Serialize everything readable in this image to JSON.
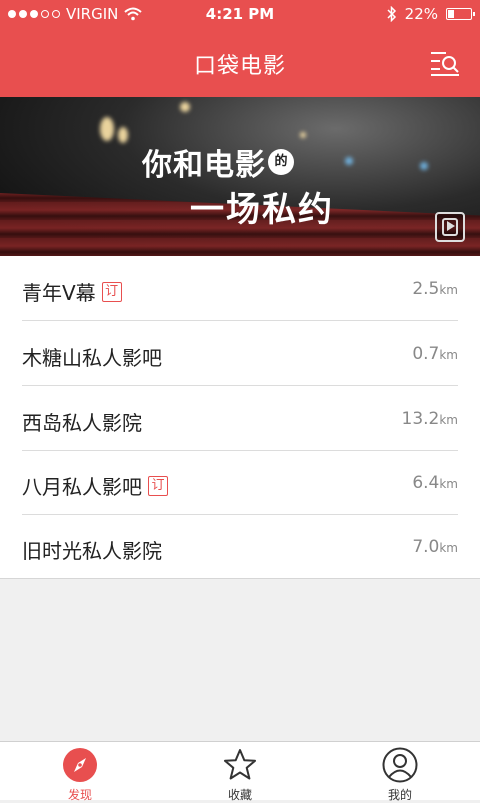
{
  "status_bar": {
    "carrier": "VIRGIN",
    "time": "4:21 PM",
    "battery": "22%"
  },
  "header": {
    "title": "口袋电影"
  },
  "banner": {
    "line1": "你和电影",
    "badge": "的",
    "line2": "一场私约"
  },
  "cinemas": [
    {
      "name": "青年V幕",
      "tag": "订",
      "distance": "2.5",
      "unit": "km"
    },
    {
      "name": "木糖山私人影吧",
      "tag": "",
      "distance": "0.7",
      "unit": "km"
    },
    {
      "name": "西岛私人影院",
      "tag": "",
      "distance": "13.2",
      "unit": "km"
    },
    {
      "name": "八月私人影吧",
      "tag": "订",
      "distance": "6.4",
      "unit": "km"
    },
    {
      "name": "旧时光私人影院",
      "tag": "",
      "distance": "7.0",
      "unit": "km"
    }
  ],
  "tabs": [
    {
      "label": "发现",
      "icon": "compass-icon",
      "active": true
    },
    {
      "label": "收藏",
      "icon": "star-icon",
      "active": false
    },
    {
      "label": "我的",
      "icon": "profile-icon",
      "active": false
    }
  ],
  "colors": {
    "accent": "#e84f4f"
  }
}
